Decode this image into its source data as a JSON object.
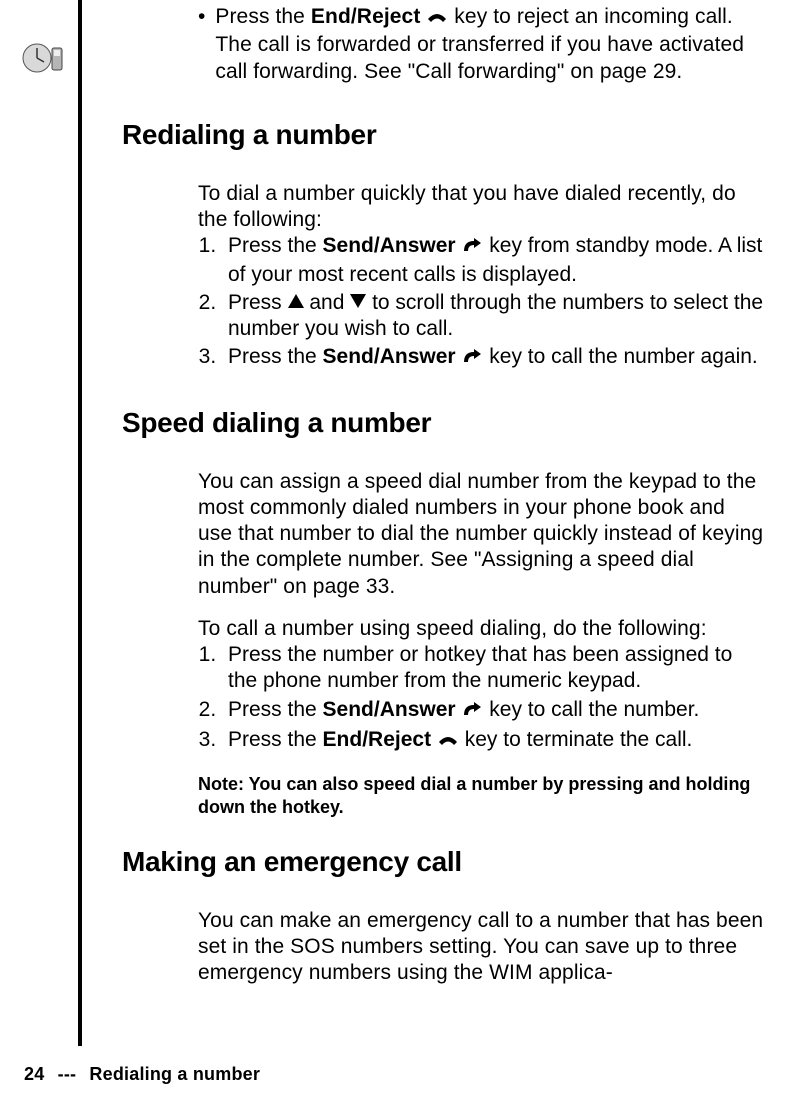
{
  "intro": {
    "bullet_prefix": "Press the ",
    "end_reject": "End/Reject",
    "bullet_suffix": " key to reject an incoming call. The call is forwarded or transferred if you have activated call forwarding. See \"Call forwarding\" on page 29."
  },
  "redial": {
    "heading": "Redialing a number",
    "lead": "To dial a number quickly that you have dialed recently, do the following:",
    "step1_prefix": "Press the ",
    "send_answer": "Send/Answer",
    "step1_suffix": " key from standby mode. A list of your most recent calls is displayed.",
    "step2_prefix": "Press ",
    "step2_mid": " and ",
    "step2_suffix": " to scroll through the numbers to select the number you wish to call.",
    "step3_prefix": "Press the ",
    "step3_suffix": " key to call the number again."
  },
  "speed": {
    "heading": "Speed dialing a number",
    "para1": "You can assign a speed dial number from the keypad to the most commonly dialed numbers in your phone book and use that number to dial the number quickly instead of keying in the complete number. See \"Assigning a speed dial number\" on page 33.",
    "lead": "To call a number using speed dialing, do the following:",
    "step1": "Press the number or hotkey that has been assigned to the phone number from the numeric keypad.",
    "step2_prefix": "Press the ",
    "step2_suffix": " key to call the number.",
    "step3_prefix": "Press the ",
    "step3_suffix": " key to terminate the call.",
    "note": "Note: You can also speed dial a number by pressing and holding down the hotkey."
  },
  "emergency": {
    "heading": "Making an emergency call",
    "para": "You can make an emergency call to a number that has been set in the SOS numbers setting. You can save up to three emergency numbers using the WIM applica-"
  },
  "footer": {
    "page": "24",
    "dashes": "---",
    "title": "Redialing a number"
  },
  "icons": {
    "end_reject": "end-call-icon",
    "send_answer": "send-call-icon",
    "up": "up-arrow-icon",
    "down": "down-arrow-icon",
    "margin": "manual-section-icon"
  }
}
